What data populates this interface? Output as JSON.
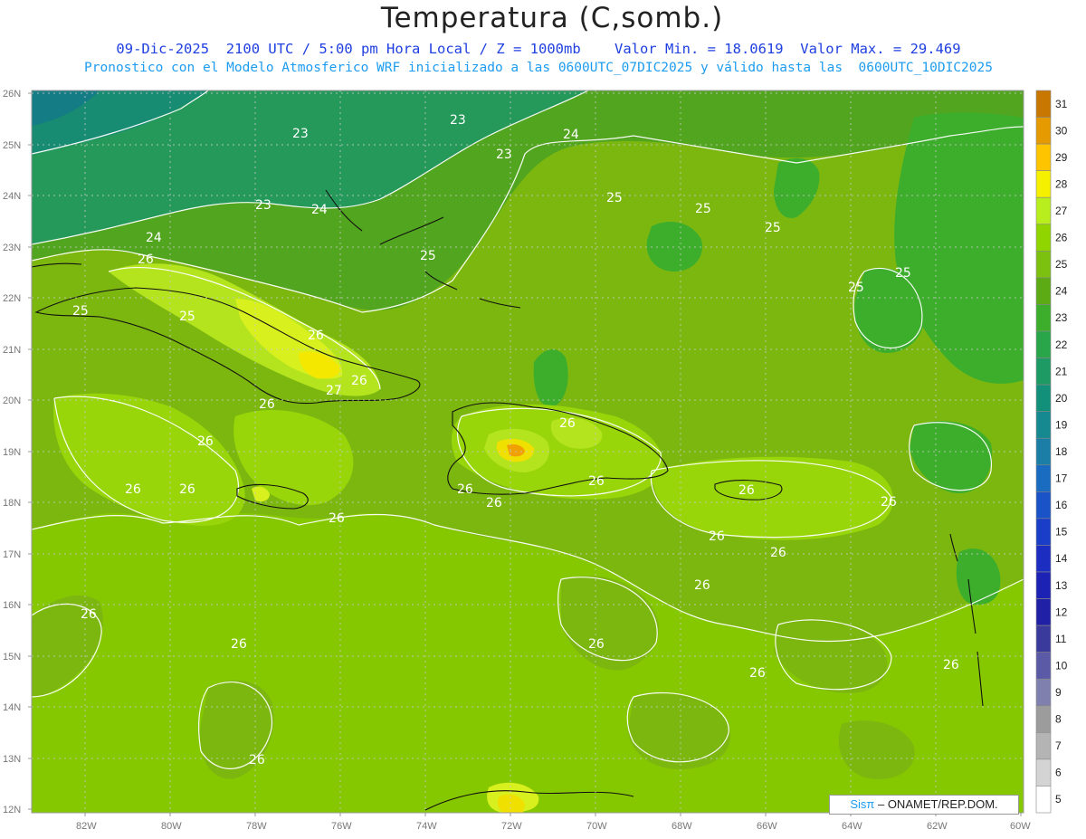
{
  "header": {
    "title": "Temperatura (C,somb.)",
    "subtitle1": "09-Dic-2025  2100 UTC / 5:00 pm Hora Local / Z = 1000mb    Valor Min. = 18.0619  Valor Max. = 29.469",
    "subtitle2": "Pronostico con el Modelo Atmosferico WRF inicializado a las 0600UTC_07DIC2025 y válido hasta las  0600UTC_10DIC2025"
  },
  "map": {
    "lat_labels": [
      "26N",
      "25N",
      "24N",
      "23N",
      "22N",
      "21N",
      "20N",
      "19N",
      "18N",
      "17N",
      "16N",
      "15N",
      "14N",
      "13N",
      "12N"
    ],
    "lon_labels": [
      "82W",
      "80W",
      "78W",
      "76W",
      "74W",
      "72W",
      "70W",
      "68W",
      "66W",
      "64W",
      "62W",
      "60W"
    ],
    "contour_labels": [
      "23",
      "23",
      "23",
      "24",
      "24",
      "23",
      "24",
      "25",
      "25",
      "25",
      "25",
      "25",
      "25",
      "25",
      "25",
      "26",
      "26",
      "26",
      "26",
      "26",
      "26",
      "26",
      "26",
      "26",
      "26",
      "26",
      "26",
      "26",
      "26",
      "26",
      "26",
      "26",
      "26",
      "26",
      "27",
      "26",
      "26",
      "26",
      "26"
    ],
    "colors": {
      "t23": "#1e9e5a",
      "t24": "#3cb83a",
      "t25": "#5aa81e",
      "t26": "#7cc314",
      "t27": "#90d400",
      "t28": "#b4e41e",
      "t29": "#f0e600",
      "t30": "#ffc000",
      "t31": "#e08a00"
    }
  },
  "colorbar": {
    "labels": [
      "31",
      "30",
      "29",
      "28",
      "27",
      "26",
      "25",
      "24",
      "23",
      "22",
      "21",
      "20",
      "19",
      "18",
      "17",
      "16",
      "15",
      "14",
      "13",
      "12",
      "11",
      "10",
      "9",
      "8",
      "7",
      "6",
      "5"
    ],
    "colors": [
      "#c87800",
      "#e49a00",
      "#ffc400",
      "#f4f000",
      "#b8ee1e",
      "#90d400",
      "#7cc010",
      "#5caa14",
      "#3cae2c",
      "#2aa64a",
      "#1e9a64",
      "#13907a",
      "#168890",
      "#1a7ea6",
      "#1a6cc0",
      "#1a52c8",
      "#1a3ec8",
      "#1c2ec2",
      "#1c22b4",
      "#2020a6",
      "#3a3a9c",
      "#5a5aa6",
      "#8080ae",
      "#9c9c9c",
      "#b4b4b4",
      "#d4d4d4",
      "#ffffff"
    ]
  },
  "credit": {
    "brand": "Sisπ",
    "text": " – ONAMET/REP.DOM."
  }
}
